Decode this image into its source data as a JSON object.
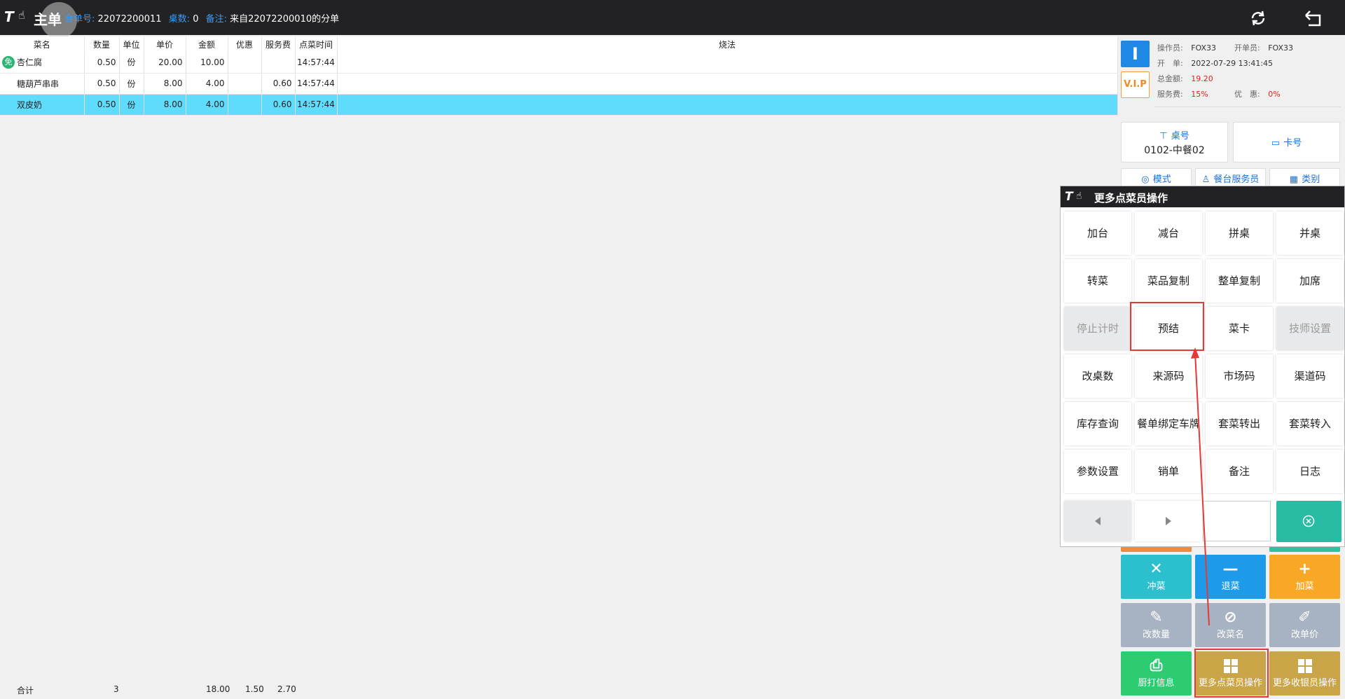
{
  "header": {
    "logo_text": "T",
    "title": "主单",
    "order_no_label": "会单号:",
    "order_no": "22072200011",
    "table_count_label": "桌数:",
    "table_count": "0",
    "remark_label": "备注:",
    "remark": "来自22072200010的分单"
  },
  "order_table": {
    "columns": [
      "菜名",
      "数量",
      "单位",
      "单价",
      "金额",
      "优惠",
      "服务费",
      "点菜时间",
      "烧法"
    ],
    "rows": [
      {
        "name": "杏仁腐",
        "qty": "0.50",
        "unit": "份",
        "price": "20.00",
        "amount": "10.00",
        "discount": "",
        "service": "",
        "time": "14:57:44",
        "method": "",
        "free_badge": "免"
      },
      {
        "name": "糖葫芦串串",
        "qty": "0.50",
        "unit": "份",
        "price": "8.00",
        "amount": "4.00",
        "discount": "",
        "service": "0.60",
        "time": "14:57:44",
        "method": ""
      },
      {
        "name": "双皮奶",
        "qty": "0.50",
        "unit": "份",
        "price": "8.00",
        "amount": "4.00",
        "discount": "",
        "service": "0.60",
        "time": "14:57:44",
        "method": "",
        "selected": true
      }
    ],
    "totals": {
      "label": "合计",
      "qty": "3",
      "amount": "18.00",
      "discount": "1.50",
      "service": "2.70"
    }
  },
  "right_panel": {
    "btn_i": "I",
    "btn_vip": "V.I.P",
    "operator_label": "操作员:",
    "operator": "FOX33",
    "opener_label": "开单员:",
    "opener": "FOX33",
    "open_time_label": "开　单:",
    "open_time": "2022-07-29 13:41:45",
    "total_label": "总金额:",
    "total": "19.20",
    "service_label": "服务费:",
    "service": "15%",
    "discount_label": "优　惠:",
    "discount": "0%",
    "table_label": "桌号",
    "table_value": "0102-中餐02",
    "card_label": "卡号",
    "mode_label": "模式",
    "waiter_label": "餐台服务员",
    "category_label": "类别",
    "actions": {
      "rush": "冲菜",
      "return": "退菜",
      "add": "加菜",
      "change_qty": "改数量",
      "rename": "改菜名",
      "change_price": "改单价",
      "kitchen_print": "厨打信息",
      "more_ordering": "更多点菜员操作",
      "more_cashier": "更多收银员操作"
    }
  },
  "popup": {
    "title": "更多点菜员操作",
    "buttons": [
      {
        "label": "加台",
        "disabled": false
      },
      {
        "label": "减台",
        "disabled": false
      },
      {
        "label": "拼桌",
        "disabled": false
      },
      {
        "label": "并桌",
        "disabled": false
      },
      {
        "label": "转菜",
        "disabled": false
      },
      {
        "label": "菜品复制",
        "disabled": false
      },
      {
        "label": "整单复制",
        "disabled": false
      },
      {
        "label": "加席",
        "disabled": false
      },
      {
        "label": "停止计时",
        "disabled": true
      },
      {
        "label": "预结",
        "disabled": false
      },
      {
        "label": "菜卡",
        "disabled": false
      },
      {
        "label": "技师设置",
        "disabled": true
      },
      {
        "label": "改桌数",
        "disabled": false
      },
      {
        "label": "来源码",
        "disabled": false
      },
      {
        "label": "市场码",
        "disabled": false
      },
      {
        "label": "渠道码",
        "disabled": false
      },
      {
        "label": "库存查询",
        "disabled": false
      },
      {
        "label": "餐单绑定车牌",
        "disabled": false
      },
      {
        "label": "套菜转出",
        "disabled": false
      },
      {
        "label": "套菜转入",
        "disabled": false
      },
      {
        "label": "参数设置",
        "disabled": false
      },
      {
        "label": "销单",
        "disabled": false
      },
      {
        "label": "备注",
        "disabled": false
      },
      {
        "label": "日志",
        "disabled": false
      }
    ]
  },
  "colors": {
    "topbar": "#222224",
    "selected_row": "#5fdcfc",
    "teal": "#28bca5",
    "cyan_action": "#2cc0cf",
    "blue_action": "#1e9be8",
    "orange_action": "#f9a825",
    "disabled_action": "#a7b3c2",
    "green_action": "#2ecc71",
    "gold_action": "#c9a548",
    "highlight": "#e53935"
  }
}
